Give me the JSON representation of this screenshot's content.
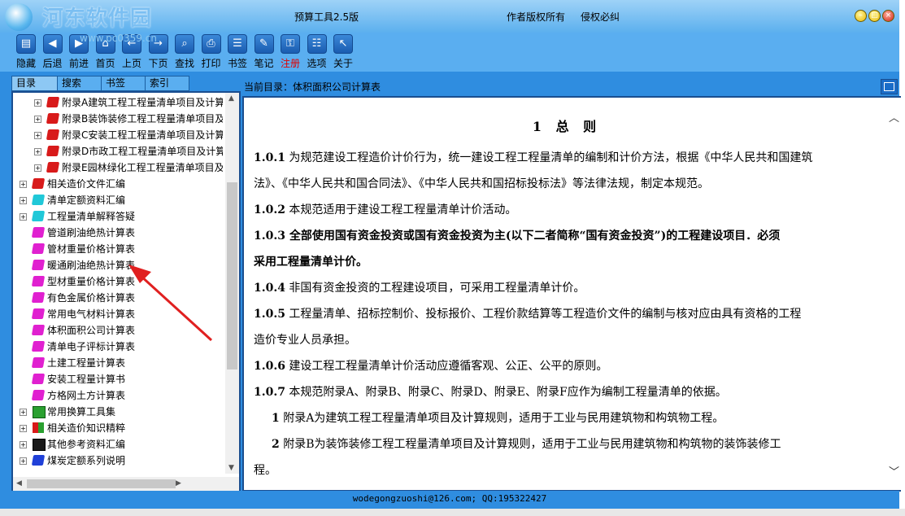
{
  "window": {
    "title": "预算工具2.5版",
    "copyright": "作者版权所有",
    "rights": "侵权必纠",
    "watermark": "河东软件园",
    "watermark_url": "www.pc0359.cn"
  },
  "toolbar": {
    "items": [
      {
        "label": "隐藏",
        "icon": "hide-icon"
      },
      {
        "label": "后退",
        "icon": "back-icon"
      },
      {
        "label": "前进",
        "icon": "forward-icon"
      },
      {
        "label": "首页",
        "icon": "home-icon"
      },
      {
        "label": "上页",
        "icon": "prev-page-icon"
      },
      {
        "label": "下页",
        "icon": "next-page-icon"
      },
      {
        "label": "查找",
        "icon": "find-icon"
      },
      {
        "label": "打印",
        "icon": "print-icon"
      },
      {
        "label": "书签",
        "icon": "bookmark-icon"
      },
      {
        "label": "笔记",
        "icon": "note-icon"
      },
      {
        "label": "注册",
        "icon": "register-icon"
      },
      {
        "label": "选项",
        "icon": "options-icon"
      },
      {
        "label": "关于",
        "icon": "about-icon"
      }
    ]
  },
  "left_tabs": [
    "目录",
    "搜索",
    "书签",
    "索引"
  ],
  "tree": [
    {
      "label": "附录A建筑工程工程量清单项目及计算",
      "level": 2,
      "icon": "red"
    },
    {
      "label": "附录B装饰装修工程工程量清单项目及",
      "level": 2,
      "icon": "red"
    },
    {
      "label": "附录C安装工程工程量清单项目及计算",
      "level": 2,
      "icon": "red"
    },
    {
      "label": "附录D市政工程工程量清单项目及计算",
      "level": 2,
      "icon": "red"
    },
    {
      "label": "附录E园林绿化工程工程量清单项目及",
      "level": 2,
      "icon": "red"
    },
    {
      "label": "相关造价文件汇编",
      "level": 1,
      "icon": "red"
    },
    {
      "label": "清单定额资料汇编",
      "level": 1,
      "icon": "cyan"
    },
    {
      "label": "工程量清单解释答疑",
      "level": 1,
      "icon": "cyan"
    },
    {
      "label": "管道刷油绝热计算表",
      "level": 1,
      "icon": "mag"
    },
    {
      "label": "管材重量价格计算表",
      "level": 1,
      "icon": "mag"
    },
    {
      "label": "暖通刷油绝热计算表",
      "level": 1,
      "icon": "mag"
    },
    {
      "label": "型材重量价格计算表",
      "level": 1,
      "icon": "mag"
    },
    {
      "label": "有色金属价格计算表",
      "level": 1,
      "icon": "mag"
    },
    {
      "label": "常用电气材料计算表",
      "level": 1,
      "icon": "mag"
    },
    {
      "label": "体积面积公司计算表",
      "level": 1,
      "icon": "mag"
    },
    {
      "label": "清单电子评标计算表",
      "level": 1,
      "icon": "mag"
    },
    {
      "label": "土建工程量计算表",
      "level": 1,
      "icon": "mag"
    },
    {
      "label": "安装工程量计算书",
      "level": 1,
      "icon": "mag"
    },
    {
      "label": "方格网土方计算表",
      "level": 1,
      "icon": "mag"
    },
    {
      "label": "常用换算工具集",
      "level": 1,
      "icon": "grn"
    },
    {
      "label": "相关造价知识精粹",
      "level": 1,
      "icon": "mix"
    },
    {
      "label": "其他参考资料汇编",
      "level": 1,
      "icon": "blk"
    },
    {
      "label": "煤炭定额系列说明",
      "level": 1,
      "icon": "blu"
    }
  ],
  "current_dir": "当前目录：体积面积公司计算表",
  "content": {
    "heading": "1 总 则",
    "paragraphs": [
      {
        "num": "1.0.1",
        "text": " 为规范建设工程造价计价行为，统一建设工程工程量清单的编制和计价方法，根据《中华人民共和国建筑"
      },
      {
        "num": "",
        "text": "法》、《中华人民共和国合同法》、《中华人民共和国招标投标法》等法律法规，制定本规范。"
      },
      {
        "num": "1.0.2",
        "text": " 本规范适用于建设工程工程量清单计价活动。"
      },
      {
        "num": "1.0.3",
        "text": "  全部使用国有资金投资或国有资金投资为主(以下二者简称“国有资金投资”)的工程建设项目．必须",
        "bold": true
      },
      {
        "num": "",
        "text": "采用工程量清单计价。",
        "bold": true
      },
      {
        "num": "1.0.4",
        "text": " 非国有资金投资的工程建设项目，可采用工程量清单计价。"
      },
      {
        "num": "1.0.5",
        "text": "  工程量清单、招标控制价、投标报价、工程价款结算等工程造价文件的编制与核对应由具有资格的工程"
      },
      {
        "num": "",
        "text": "造价专业人员承担。"
      },
      {
        "num": "1.0.6",
        "text": "   建设工程工程量清单计价活动应遵循客观、公正、公平的原则。"
      },
      {
        "num": "1.0.7",
        "text": "  本规范附录A、附录B、附录C、附录D、附录E、附录F应作为编制工程量清单的依据。"
      },
      {
        "num": "1",
        "text": " 附录A为建筑工程工程量清单项目及计算规则，适用于工业与民用建筑物和构筑物工程。",
        "indent": true
      },
      {
        "num": "2",
        "text": " 附录B为装饰装修工程工程量清单项目及计算规则，适用于工业与民用建筑物和构筑物的装饰装修工",
        "indent": true
      },
      {
        "num": "",
        "text": "程。"
      }
    ]
  },
  "status": "wodegongzuoshi@126.com; QQ:195322427"
}
